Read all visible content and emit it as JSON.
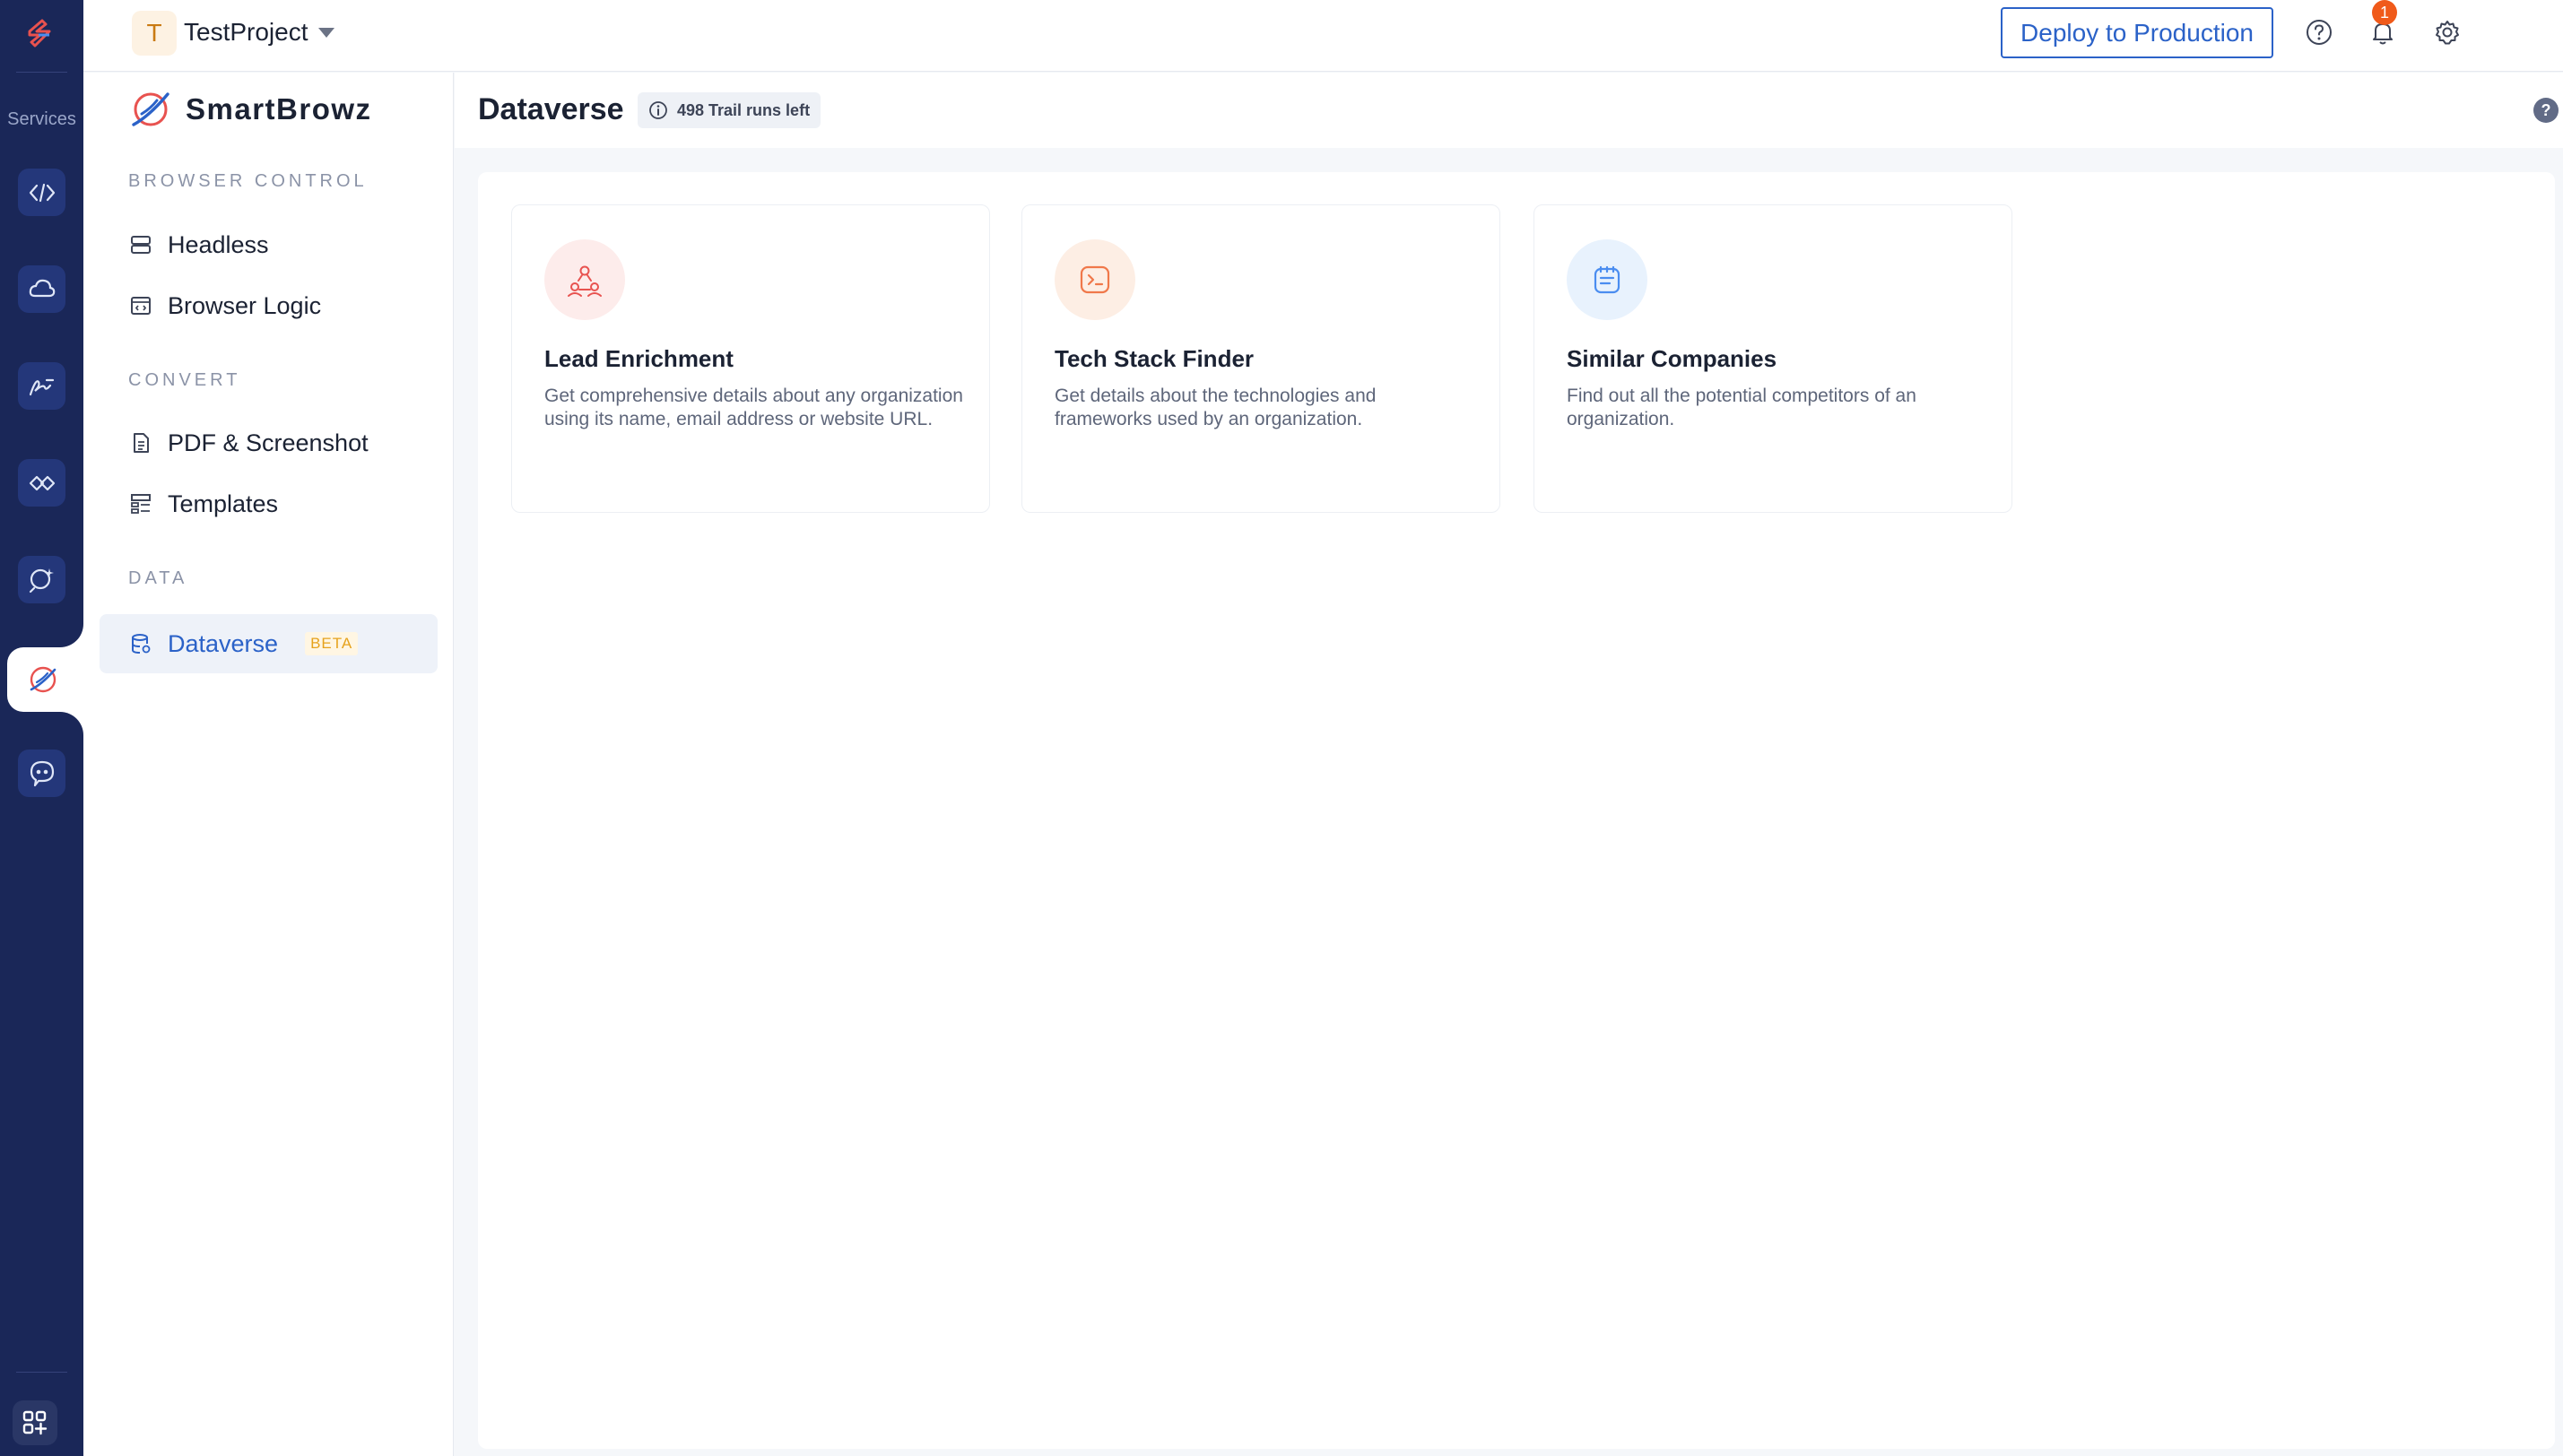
{
  "rail": {
    "services_label": "Services",
    "items": [
      "api-icon",
      "cloud-icon",
      "signature-icon",
      "link-icon",
      "search-spark-icon",
      "smartbrowz-icon",
      "chat-icon"
    ],
    "active": "smartbrowz-icon"
  },
  "topbar": {
    "project_initial": "T",
    "project_name": "TestProject",
    "deploy_label": "Deploy to Production",
    "notification_count": "1"
  },
  "sidebar": {
    "brand": "SmartBrowz",
    "sections": [
      {
        "label": "BROWSER CONTROL",
        "items": [
          {
            "label": "Headless"
          },
          {
            "label": "Browser Logic"
          }
        ]
      },
      {
        "label": "CONVERT",
        "items": [
          {
            "label": "PDF & Screenshot"
          },
          {
            "label": "Templates"
          }
        ]
      },
      {
        "label": "DATA",
        "items": [
          {
            "label": "Dataverse",
            "badge": "BETA",
            "active": true
          }
        ]
      }
    ]
  },
  "main": {
    "title": "Dataverse",
    "trail_runs": "498 Trail runs left",
    "help": "?",
    "cards": [
      {
        "title": "Lead Enrichment",
        "description": "Get comprehensive details about any organization using its name, email address or website URL.",
        "icon": "users-network-icon",
        "accent": "#fdeceb"
      },
      {
        "title": "Tech Stack Finder",
        "description": "Get details about the technologies and frameworks used by an organization.",
        "icon": "terminal-icon",
        "accent": "#fdeee4"
      },
      {
        "title": "Similar Companies",
        "description": "Find out all the potential competitors of an organization.",
        "icon": "document-icon",
        "accent": "#e8f2fd"
      }
    ]
  },
  "colors": {
    "rail": "#1a2758",
    "accent": "#2b62c8",
    "beta": "#e6a21c",
    "notification": "#f05a1a"
  }
}
